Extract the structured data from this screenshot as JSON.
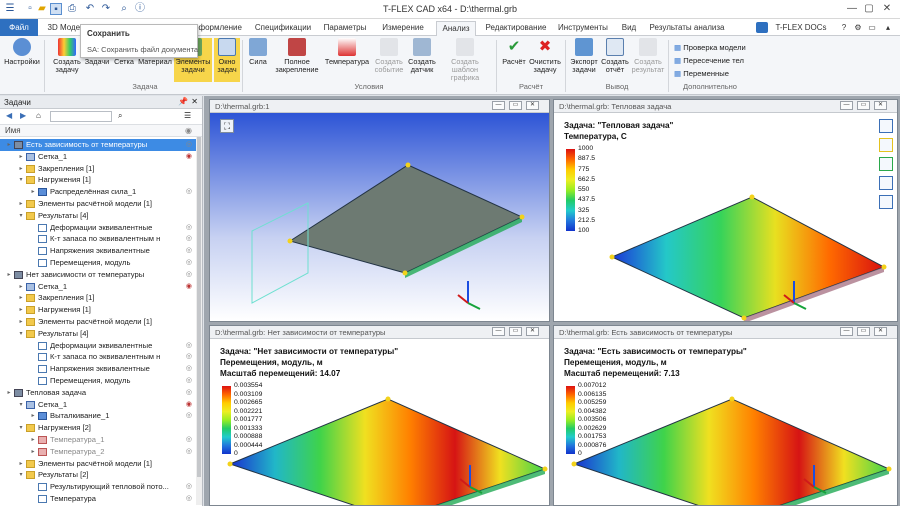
{
  "app": {
    "title": "T-FLEX CAD x64 - D:\\thermal.grb",
    "docs_label": "T-FLEX DOCs"
  },
  "tooltip": {
    "title": "Сохранить",
    "desc": "SA: Сохранить файл документа"
  },
  "tabs": [
    "Файл",
    "3D Модел",
    "оформление",
    "Спецификации",
    "Параметры",
    "Измерение",
    "Анализ",
    "Редактирование",
    "Инструменты",
    "Вид",
    "Результаты анализа"
  ],
  "ribbon": {
    "buttons": [
      "Настройки",
      "Создать задачу",
      "Задачи",
      "Сетка",
      "Материал",
      "Элементы задачи",
      "Окно задач",
      "Сила",
      "Полное закрепление",
      "Температура",
      "Создать событие",
      "Создать датчик",
      "Создать шаблон графика",
      "Расчёт",
      "Очистить задачу",
      "Экспорт задачи",
      "Создать отчёт",
      "Создать результат"
    ],
    "side": [
      "Проверка модели",
      "Пересечение тел",
      "Переменные"
    ],
    "groups": [
      "Задача",
      "Условия",
      "Расчёт",
      "Вывод",
      "Дополнительно"
    ]
  },
  "panel": {
    "title": "Задачи",
    "col_name": "Имя"
  },
  "tree": [
    {
      "d": 0,
      "t": "Есть зависимость от температуры",
      "sel": true,
      "i": "task"
    },
    {
      "d": 1,
      "t": "Сетка_1",
      "i": "mesh"
    },
    {
      "d": 1,
      "t": "Закрепления [1]",
      "i": "folder"
    },
    {
      "d": 1,
      "t": "Нагружения [1]",
      "i": "folder",
      "open": true
    },
    {
      "d": 2,
      "t": "Распределённая сила_1",
      "i": "force"
    },
    {
      "d": 1,
      "t": "Элементы расчётной модели [1]",
      "i": "folder"
    },
    {
      "d": 1,
      "t": "Результаты [4]",
      "i": "folder",
      "open": true
    },
    {
      "d": 2,
      "t": "Деформации эквивалентные",
      "i": "doc"
    },
    {
      "d": 2,
      "t": "К-т запаса по эквивалентным н",
      "i": "doc"
    },
    {
      "d": 2,
      "t": "Напряжения эквивалентные",
      "i": "doc"
    },
    {
      "d": 2,
      "t": "Перемещения, модуль",
      "i": "doc"
    },
    {
      "d": 0,
      "t": "Нет зависимости от температуры",
      "i": "task"
    },
    {
      "d": 1,
      "t": "Сетка_1",
      "i": "mesh"
    },
    {
      "d": 1,
      "t": "Закрепления [1]",
      "i": "folder"
    },
    {
      "d": 1,
      "t": "Нагружения [1]",
      "i": "folder"
    },
    {
      "d": 1,
      "t": "Элементы расчётной модели [1]",
      "i": "folder"
    },
    {
      "d": 1,
      "t": "Результаты [4]",
      "i": "folder",
      "open": true
    },
    {
      "d": 2,
      "t": "Деформации эквивалентные",
      "i": "doc"
    },
    {
      "d": 2,
      "t": "К-т запаса по эквивалентным н",
      "i": "doc"
    },
    {
      "d": 2,
      "t": "Напряжения эквивалентные",
      "i": "doc"
    },
    {
      "d": 2,
      "t": "Перемещения, модуль",
      "i": "doc"
    },
    {
      "d": 0,
      "t": "Тепловая задача",
      "i": "task"
    },
    {
      "d": 1,
      "t": "Сетка_1",
      "i": "mesh",
      "open": true
    },
    {
      "d": 2,
      "t": "Выталкивание_1",
      "i": "force"
    },
    {
      "d": 1,
      "t": "Нагружения [2]",
      "i": "folder",
      "open": true
    },
    {
      "d": 2,
      "t": "Температура_1",
      "i": "temp",
      "dim": true
    },
    {
      "d": 2,
      "t": "Температура_2",
      "i": "temp",
      "dim": true
    },
    {
      "d": 1,
      "t": "Элементы расчётной модели [1]",
      "i": "folder"
    },
    {
      "d": 1,
      "t": "Результаты [2]",
      "i": "folder",
      "open": true
    },
    {
      "d": 2,
      "t": "Результирующий тепловой пото...",
      "i": "doc"
    },
    {
      "d": 2,
      "t": "Температура",
      "i": "doc"
    }
  ],
  "viewports": [
    {
      "title": "D:\\thermal.grb:1",
      "caption": [],
      "legend": []
    },
    {
      "title": "D:\\thermal.grb: Тепловая задача",
      "caption": [
        "Задача: \"Тепловая задача\"",
        "Температура, С"
      ],
      "legend": [
        "1000",
        "887.5",
        "775",
        "662.5",
        "550",
        "437.5",
        "325",
        "212.5",
        "100"
      ]
    },
    {
      "title": "D:\\thermal.grb: Нет зависимости от температуры",
      "caption": [
        "Задача: \"Нет зависимости от температуры\"",
        "Перемещения, модуль, м",
        "Масштаб перемещений: 14.07"
      ],
      "legend": [
        "0.003554",
        "0.003109",
        "0.002665",
        "0.002221",
        "0.001777",
        "0.001333",
        "0.000888",
        "0.000444",
        "0"
      ]
    },
    {
      "title": "D:\\thermal.grb: Есть зависимость от температуры",
      "caption": [
        "Задача: \"Есть зависимость от температуры\"",
        "Перемещения, модуль, м",
        "Масштаб перемещений: 7.13"
      ],
      "legend": [
        "0.007012",
        "0.006135",
        "0.005259",
        "0.004382",
        "0.003506",
        "0.002629",
        "0.001753",
        "0.000876",
        "0"
      ]
    }
  ]
}
